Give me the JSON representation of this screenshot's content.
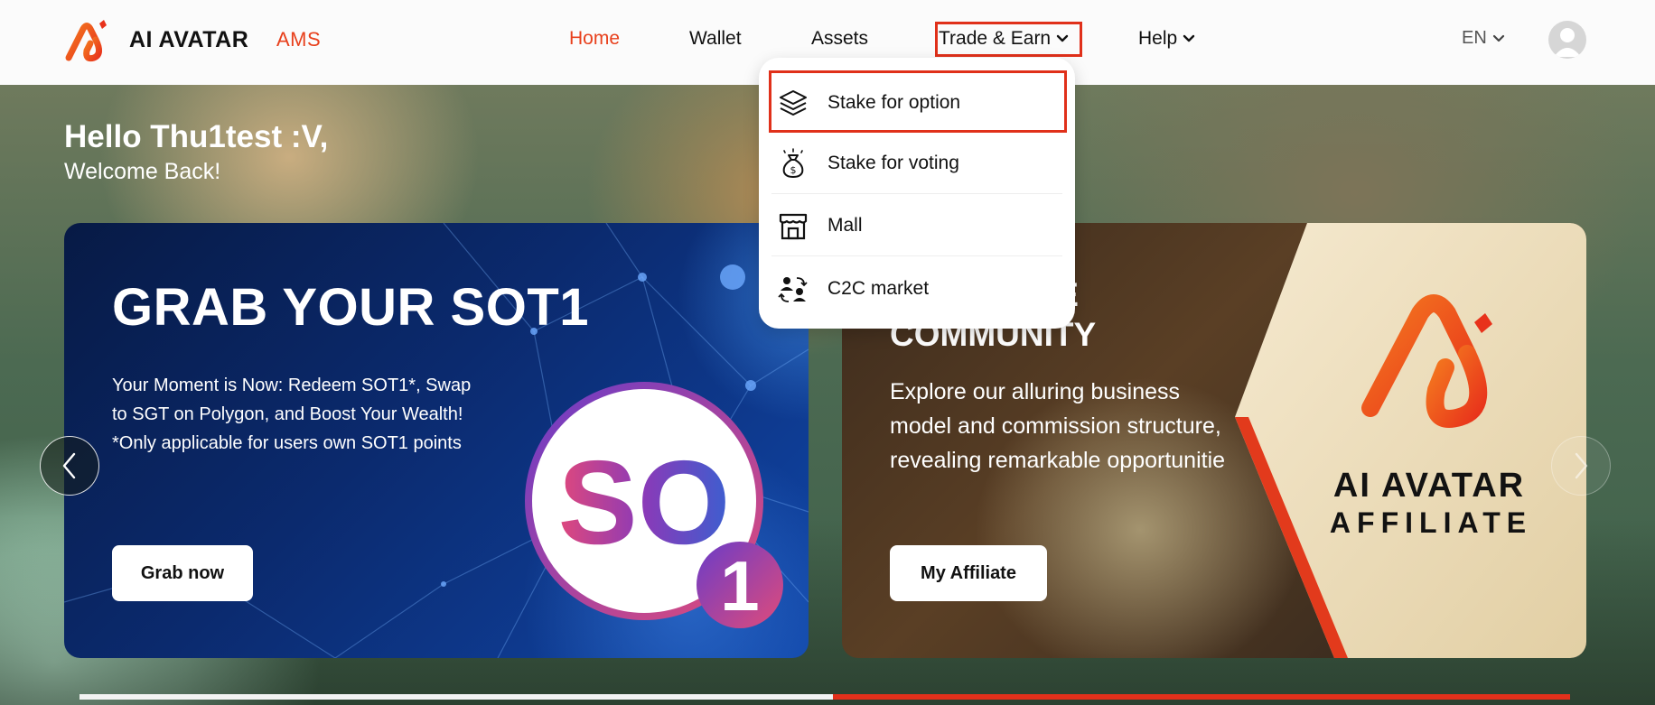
{
  "header": {
    "brand": "AI AVATAR",
    "brand_sub": "AMS",
    "nav": {
      "home": "Home",
      "wallet": "Wallet",
      "assets": "Assets",
      "trade": "Trade & Earn",
      "help": "Help"
    },
    "language": "EN"
  },
  "dropdown": {
    "items": [
      {
        "label": "Stake for option",
        "icon": "layers-icon"
      },
      {
        "label": "Stake for voting",
        "icon": "money-bag-icon"
      },
      {
        "label": "Mall",
        "icon": "store-icon"
      },
      {
        "label": "C2C market",
        "icon": "users-exchange-icon"
      }
    ]
  },
  "greeting": {
    "title": "Hello Thu1test :V,",
    "subtitle": "Welcome Back!"
  },
  "banners": [
    {
      "title": "GRAB YOUR SOT1",
      "lines": [
        "Your Moment is Now: Redeem SOT1*, Swap",
        "to SGT on Polygon, and Boost Your Wealth!",
        "*Only applicable for users own SOT1 points"
      ],
      "button": "Grab now",
      "badge_text": "SO",
      "badge_number": "1"
    },
    {
      "title": "ROFITABLE COMMUNITY",
      "description": "Explore our alluring business model and commission structure, revealing remarkable opportunitie",
      "button": "My Affiliate",
      "logo_text": "AI AVATAR",
      "logo_sub": "AFFILIATE"
    }
  ],
  "carousel": {
    "progress_fraction": 0.5
  },
  "colors": {
    "accent": "#e8401c",
    "highlight": "#e0301a"
  }
}
